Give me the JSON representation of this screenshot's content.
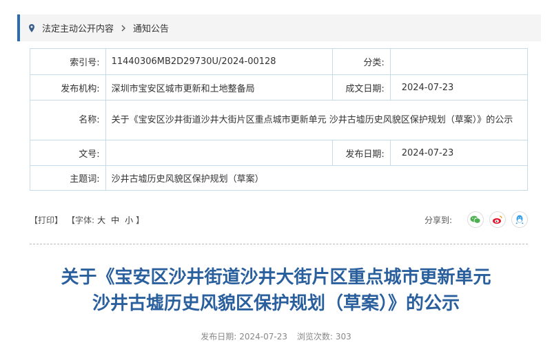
{
  "breadcrumb": {
    "item1": "法定主动公开内容",
    "item2": "通知公告"
  },
  "meta": {
    "index_label": "索引号:",
    "index_value": "11440306MB2D29730U/2024-00128",
    "category_label": "分类:",
    "category_value": "",
    "org_label": "发布机构:",
    "org_value": "深圳市宝安区城市更新和土地整备局",
    "created_label": "成文日期:",
    "created_value": "2024-07-23",
    "name_label": "名称:",
    "name_value": "关于《宝安区沙井街道沙井大街片区重点城市更新单元 沙井古墟历史风貌区保护规划（草案）》的公示",
    "docno_label": "文号:",
    "docno_value": "",
    "published_label": "发布日期:",
    "published_value": "2024-07-23",
    "subject_label": "主题词:",
    "subject_value": "沙井古墟历史风貌区保护规划（草案）"
  },
  "tools": {
    "print": "【打印】",
    "font_prefix": "【字体:",
    "font_large": "大",
    "font_medium": "中",
    "font_small": "小",
    "font_suffix": "】",
    "share_label": "分享到:"
  },
  "article": {
    "title_line1": "关于《宝安区沙井街道沙井大街片区重点城市更新单元",
    "title_line2": "沙井古墟历史风貌区保护规划（草案）》的公示",
    "date_label": "发布日期:",
    "date_value": "2024-07-23",
    "views_label": "浏览次数:",
    "views_value": "303"
  },
  "colors": {
    "accent": "#2b6cb0",
    "title": "#2a5f9e",
    "border": "#c6dbe9",
    "wechat": "#4caf50",
    "weibo": "#e6162d",
    "qq": "#3aa0e8"
  }
}
